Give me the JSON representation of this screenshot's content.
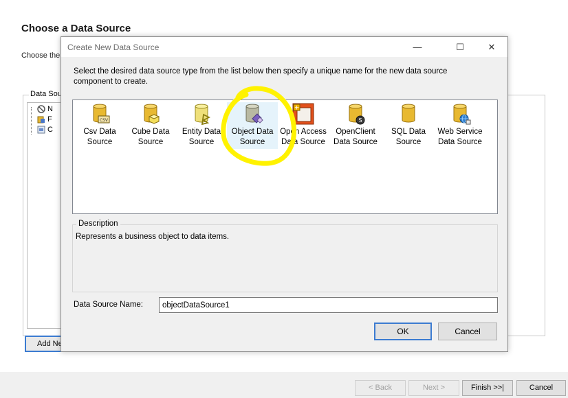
{
  "wizard": {
    "title": "Choose a Data Source",
    "subtitle": "Choose the",
    "group_label": "Data Sou",
    "tree": [
      {
        "label": "N",
        "icon": "no-entry-icon"
      },
      {
        "label": "F",
        "icon": "object-source-icon"
      },
      {
        "label": "C",
        "icon": "csv-source-icon"
      }
    ],
    "add_button": "Add Ne",
    "buttons": {
      "back": "< Back",
      "next": "Next >",
      "finish": "Finish >>|",
      "cancel": "Cancel"
    }
  },
  "dialog": {
    "title": "Create New Data Source",
    "controls": {
      "minimize": "—",
      "maximize": "☐",
      "close": "✕"
    },
    "intro": "Select the desired data source type from the list below then specify a unique name for the new data source component to create.",
    "items": [
      {
        "line1": "Csv Data",
        "line2": "Source",
        "icon": "csv-database-icon"
      },
      {
        "line1": "Cube Data",
        "line2": "Source",
        "icon": "cube-database-icon"
      },
      {
        "line1": "Entity Data",
        "line2": "Source",
        "icon": "entity-database-icon"
      },
      {
        "line1": "Object Data",
        "line2": "Source",
        "icon": "object-database-icon",
        "selected": true
      },
      {
        "line1": "Open Access",
        "line2": "Data Source",
        "icon": "open-access-icon"
      },
      {
        "line1": "OpenClient",
        "line2": "Data Source",
        "icon": "openclient-database-icon"
      },
      {
        "line1": "SQL Data",
        "line2": "Source",
        "icon": "sql-database-icon"
      },
      {
        "line1": "Web Service",
        "line2": "Data Source",
        "icon": "web-service-database-icon"
      }
    ],
    "description_label": "Description",
    "description_text": "Represents a business object to data items.",
    "name_label": "Data Source Name:",
    "name_value": "objectDataSource1",
    "ok": "OK",
    "cancel": "Cancel"
  },
  "colors": {
    "accent": "#3b7bd1",
    "cylinder": "#e8b931",
    "annotation": "#fff200",
    "selection": "#e5f3fb"
  }
}
